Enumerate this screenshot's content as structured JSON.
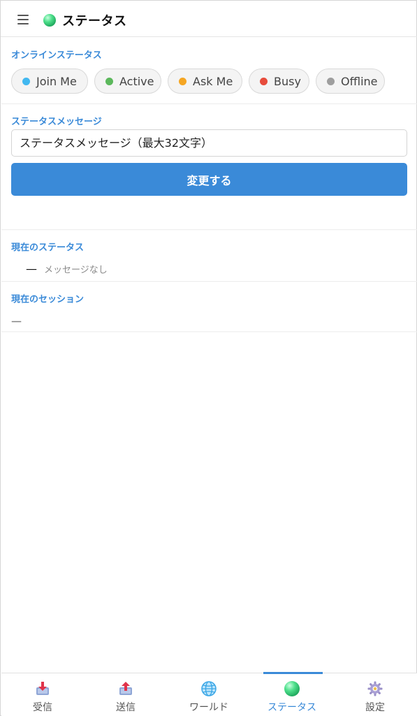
{
  "header": {
    "title": "ステータス"
  },
  "online_status": {
    "label": "オンラインステータス",
    "options": [
      {
        "label": "Join Me",
        "color": "#42b8f0"
      },
      {
        "label": "Active",
        "color": "#5cb85c"
      },
      {
        "label": "Ask Me",
        "color": "#f5a623"
      },
      {
        "label": "Busy",
        "color": "#e74c3c"
      },
      {
        "label": "Offline",
        "color": "#9e9e9e"
      }
    ]
  },
  "status_message": {
    "label": "ステータスメッセージ",
    "placeholder": "ステータスメッセージ（最大32文字）",
    "submit_label": "変更する"
  },
  "current_status": {
    "label": "現在のステータス",
    "dash": "—",
    "message": "メッセージなし"
  },
  "current_session": {
    "label": "現在のセッション",
    "value": "—"
  },
  "bottom_nav": {
    "items": [
      {
        "label": "受信",
        "icon": "inbox-download-icon"
      },
      {
        "label": "送信",
        "icon": "outbox-upload-icon"
      },
      {
        "label": "ワールド",
        "icon": "globe-icon"
      },
      {
        "label": "ステータス",
        "icon": "status-orb-icon"
      },
      {
        "label": "設定",
        "icon": "gear-icon"
      }
    ],
    "active_index": 3,
    "accent_color": "#3a8ad8"
  }
}
